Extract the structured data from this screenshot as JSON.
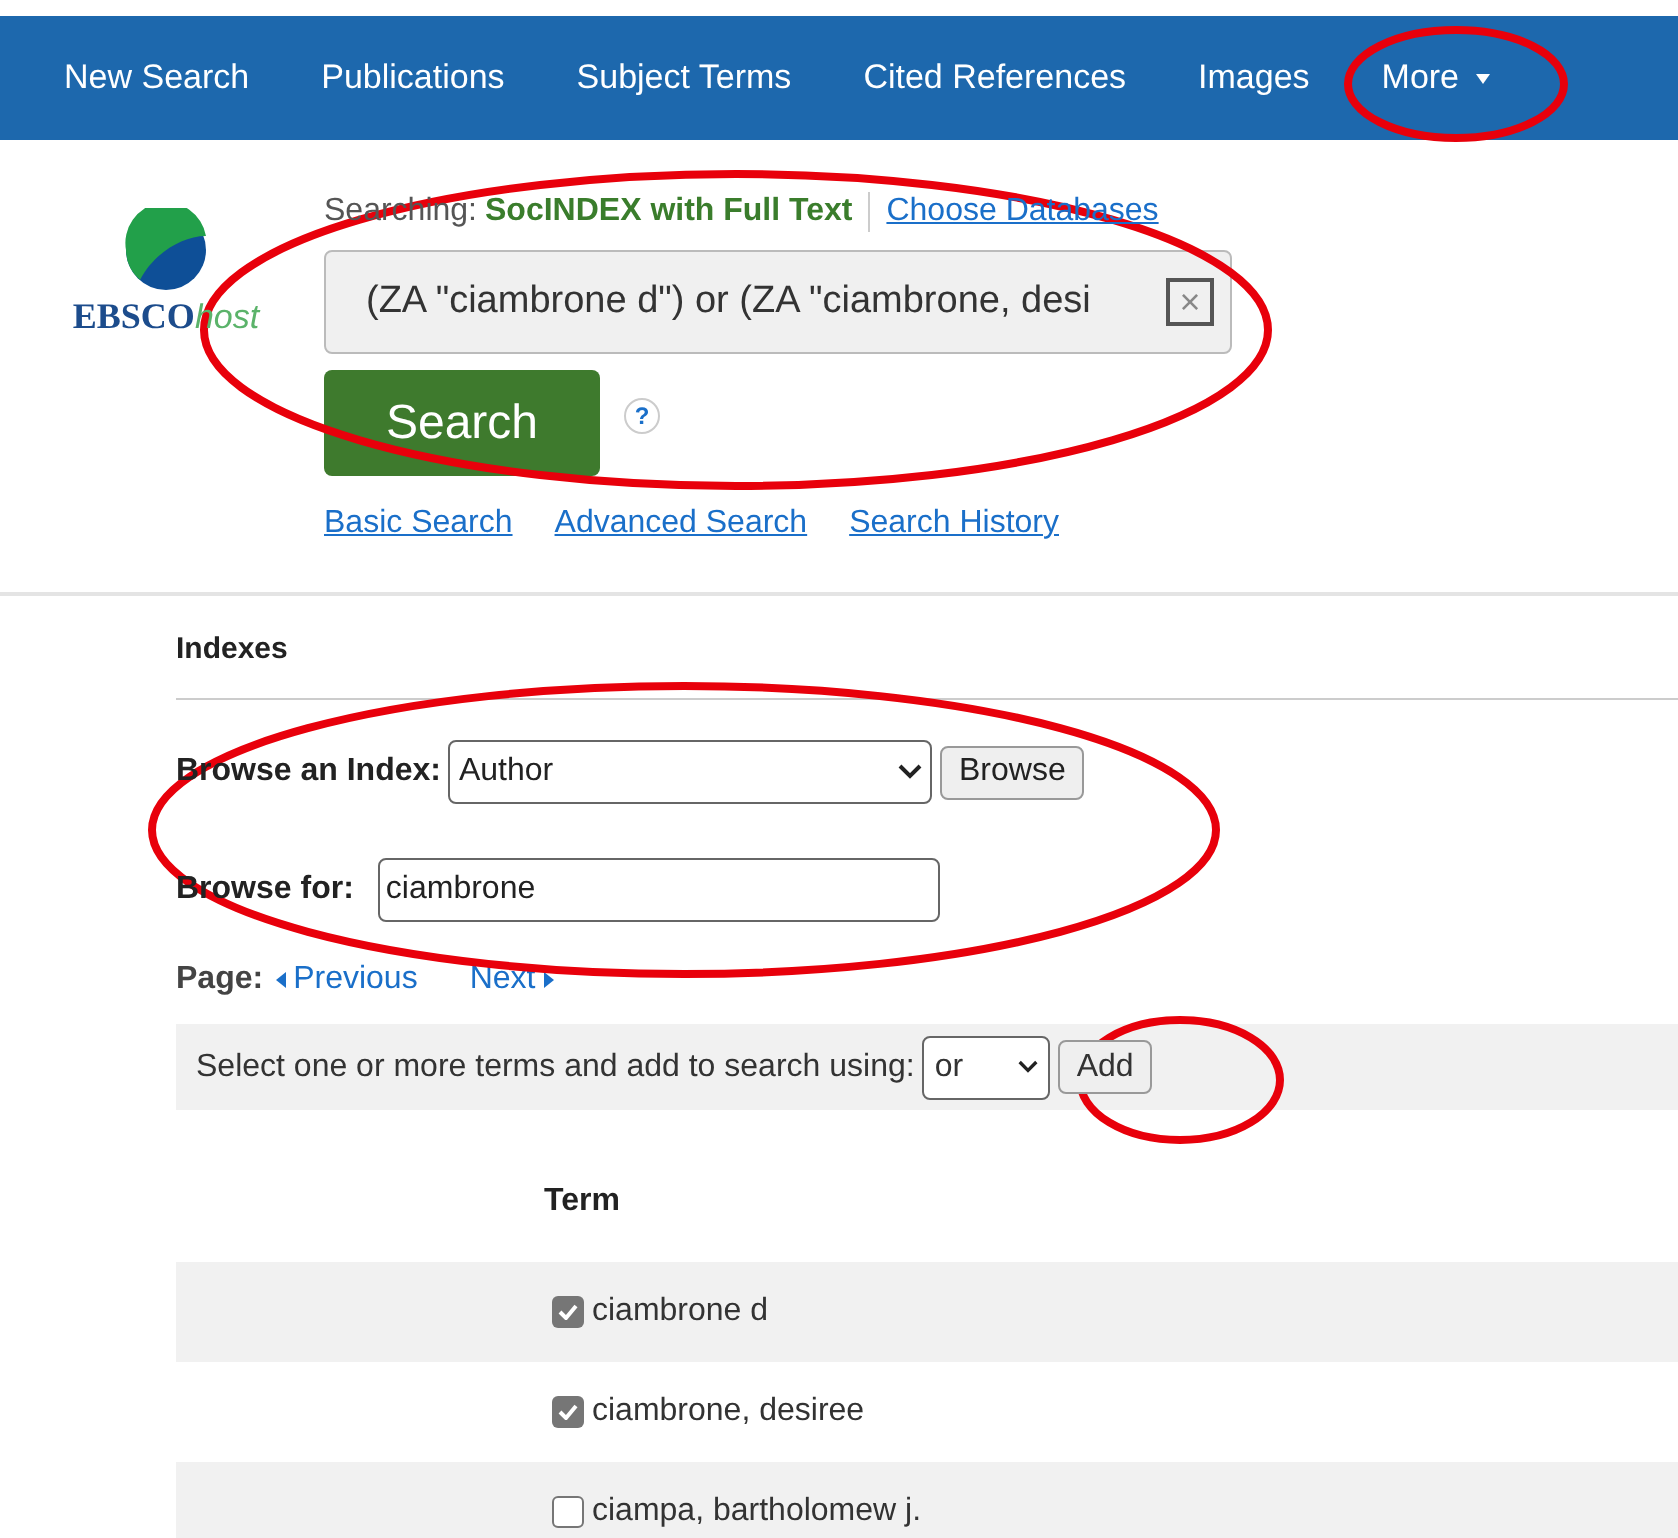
{
  "nav": {
    "items": [
      {
        "label": "New Search",
        "kind": "link"
      },
      {
        "label": "Publications",
        "kind": "link"
      },
      {
        "label": "Subject Terms",
        "kind": "link"
      },
      {
        "label": "Cited References",
        "kind": "link"
      },
      {
        "label": "Images",
        "kind": "link"
      },
      {
        "label": "More",
        "kind": "menu"
      }
    ]
  },
  "header": {
    "logo_text": "EBSCO",
    "logo_suffix": "host",
    "searching_label": "Searching:",
    "database": "SocINDEX with Full Text",
    "choose_link": "Choose Databases",
    "query": "(ZA \"ciambrone d\") or (ZA \"ciambrone, desi",
    "clear": "×",
    "search_button": "Search",
    "help": "?",
    "links": [
      "Basic Search",
      "Advanced Search",
      "Search History"
    ]
  },
  "indexes": {
    "title": "Indexes",
    "browse_label": "Browse an Index:",
    "index_value": "Author",
    "browse_button": "Browse",
    "browse_for_label": "Browse for:",
    "browse_for_value": "ciambrone",
    "page_label": "Page:",
    "previous": "Previous",
    "next": "Next",
    "select_text": "Select one or more terms and add to search using:",
    "operator": "or",
    "add_button": "Add"
  },
  "table": {
    "column": "Term",
    "rows": [
      {
        "term": "ciambrone d",
        "checked": true
      },
      {
        "term": "ciambrone, desiree",
        "checked": true
      },
      {
        "term": "ciampa, bartholomew j.",
        "checked": false
      }
    ]
  }
}
